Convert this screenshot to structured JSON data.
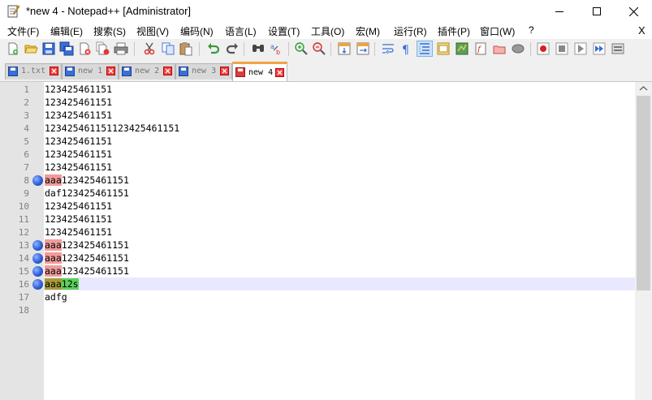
{
  "window": {
    "title": "*new 4 - Notepad++ [Administrator]",
    "app_icon": "notepad-icon",
    "controls": [
      "minimize-icon",
      "maximize-icon",
      "close-icon"
    ]
  },
  "menu": {
    "items": [
      "文件(F)",
      "编辑(E)",
      "搜索(S)",
      "视图(V)",
      "编码(N)",
      "语言(L)",
      "设置(T)",
      "工具(O)",
      "宏(M)",
      "运行(R)",
      "插件(P)",
      "窗口(W)",
      "?"
    ],
    "close_doc": "X"
  },
  "toolbar": {
    "icons": [
      "new-file-icon",
      "open-file-icon",
      "save-icon",
      "save-all-icon",
      "close-icon",
      "close-all-icon",
      "print-icon",
      "cut-icon",
      "copy-icon",
      "paste-icon",
      "undo-icon",
      "redo-icon",
      "find-icon",
      "replace-icon",
      "zoom-in-icon",
      "zoom-out-icon",
      "sync-vertical-icon",
      "sync-horizontal-icon",
      "word-wrap-icon",
      "show-all-chars-icon",
      "indent-guide-icon",
      "udl-icon",
      "doc-map-icon",
      "function-list-icon",
      "folder-workspace-icon",
      "monitoring-icon",
      "record-macro-icon",
      "stop-macro-icon",
      "play-macro-icon",
      "run-macro-multiple-icon",
      "save-macro-icon"
    ]
  },
  "tabs": [
    {
      "label": "1.txt",
      "state": "saved"
    },
    {
      "label": "new 1",
      "state": "saved"
    },
    {
      "label": "new 2",
      "state": "saved"
    },
    {
      "label": "new 3",
      "state": "saved"
    },
    {
      "label": "new 4",
      "state": "modified",
      "active": true
    }
  ],
  "editor": {
    "lines": [
      {
        "n": "1",
        "pre": "",
        "text": "123425461151",
        "mark": ""
      },
      {
        "n": "2",
        "pre": "",
        "text": "123425461151",
        "mark": ""
      },
      {
        "n": "3",
        "pre": "",
        "text": "123425461151",
        "mark": ""
      },
      {
        "n": "4",
        "pre": "",
        "text": "123425461151123425461151",
        "mark": ""
      },
      {
        "n": "5",
        "pre": "",
        "text": "123425461151",
        "mark": ""
      },
      {
        "n": "6",
        "pre": "",
        "text": "123425461151",
        "mark": ""
      },
      {
        "n": "7",
        "pre": "",
        "text": "123425461151",
        "mark": ""
      },
      {
        "n": "8",
        "pre": "aaa",
        "text": "123425461151",
        "mark": "red",
        "bookmark": true
      },
      {
        "n": "9",
        "pre": "",
        "text": "daf123425461151",
        "mark": ""
      },
      {
        "n": "10",
        "pre": "",
        "text": "123425461151",
        "mark": ""
      },
      {
        "n": "11",
        "pre": "",
        "text": "123425461151",
        "mark": ""
      },
      {
        "n": "12",
        "pre": "",
        "text": "123425461151",
        "mark": ""
      },
      {
        "n": "13",
        "pre": "aaa",
        "text": "123425461151",
        "mark": "red",
        "bookmark": true
      },
      {
        "n": "14",
        "pre": "aaa",
        "text": "123425461151",
        "mark": "red",
        "bookmark": true
      },
      {
        "n": "15",
        "pre": "aaa",
        "text": "123425461151",
        "mark": "red",
        "bookmark": true
      },
      {
        "n": "16",
        "pre": "aaa",
        "text": "12s",
        "mark": "olive-green",
        "bookmark": true,
        "current": true
      },
      {
        "n": "17",
        "pre": "",
        "text": "adfg",
        "mark": ""
      },
      {
        "n": "18",
        "pre": "",
        "text": "",
        "mark": ""
      }
    ],
    "colors": {
      "highlight_red": "#f19b9b",
      "highlight_green": "#5ad35a",
      "highlight_olive": "#a89a3a",
      "current_line": "#e8e8ff",
      "bookmark": "#2f5fd8",
      "active_tab_accent": "#f2a341"
    }
  }
}
